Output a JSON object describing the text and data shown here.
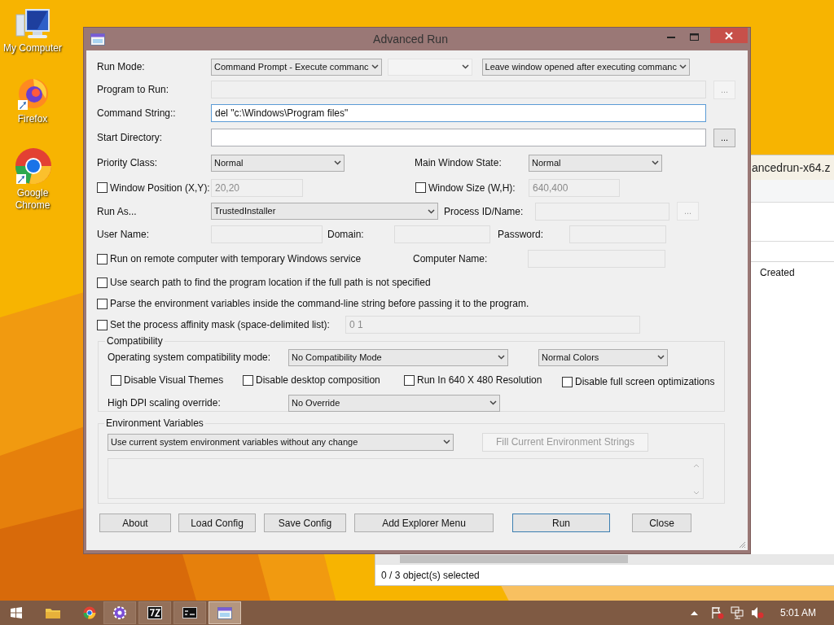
{
  "desktop_icons": [
    {
      "label": "My Computer",
      "kind": "computer"
    },
    {
      "label": "Firefox",
      "kind": "firefox"
    },
    {
      "label": "Google Chrome",
      "kind": "chrome"
    }
  ],
  "background_window": {
    "title": "ancedrun-x64.z",
    "column_header": "Created",
    "status": "0 / 3 object(s) selected"
  },
  "dialog": {
    "title": "Advanced Run",
    "run_mode": {
      "label": "Run Mode:",
      "mode": "Command Prompt - Execute commanc",
      "secondary_disabled": true,
      "window_option": "Leave window opened after executing commanc"
    },
    "program": {
      "label": "Program to Run:",
      "disabled": true,
      "browse": "...",
      "browse_disabled": true
    },
    "command": {
      "label": "Command String::",
      "value": "del \"c:\\Windows\\Program files\"",
      "focused": true
    },
    "start_dir": {
      "label": "Start Directory:",
      "disabled": false,
      "browse": "...",
      "browse_disabled": false
    },
    "priority": {
      "label": "Priority Class:",
      "value": "Normal"
    },
    "main_window_state": {
      "label": "Main Window State:",
      "value": "Normal"
    },
    "window_position": {
      "label": "Window Position (X,Y):",
      "checked": false,
      "value": "20,20",
      "disabled": true
    },
    "window_size": {
      "label": "Window Size (W,H):",
      "checked": false,
      "value": "640,400",
      "disabled": true
    },
    "run_as": {
      "label": "Run As...",
      "value": "TrustedInstaller"
    },
    "process_id": {
      "label": "Process ID/Name:",
      "disabled": true,
      "browse": "...",
      "browse_disabled": true
    },
    "credentials": [
      {
        "label": "User Name:",
        "disabled": true
      },
      {
        "label": "Domain:",
        "disabled": true
      },
      {
        "label": "Password:",
        "disabled": true
      }
    ],
    "remote": {
      "label": "Run on remote computer with temporary Windows service",
      "checked": false
    },
    "computer_name": {
      "label": "Computer Name:",
      "disabled": true
    },
    "options": [
      {
        "label": "Use search path to find the program location if the full path is not specified",
        "checked": false
      },
      {
        "label": "Parse the environment variables inside the command-line string before passing it to the program.",
        "checked": false
      }
    ],
    "affinity": {
      "label": "Set the process affinity mask (space-delimited list):",
      "checked": false,
      "value": "0 1",
      "disabled": true
    },
    "compatibility": {
      "title": "Compatibility",
      "mode_label": "Operating system compatibility mode:",
      "mode": "No Compatibility Mode",
      "colors": "Normal Colors",
      "checkboxes": [
        {
          "label": "Disable Visual Themes",
          "checked": false
        },
        {
          "label": "Disable desktop composition",
          "checked": false
        },
        {
          "label": "Run In 640 X 480 Resolution",
          "checked": false
        },
        {
          "label": "Disable full screen optimizations",
          "checked": false
        }
      ],
      "dpi_label": "High DPI scaling override:",
      "dpi": "No Override"
    },
    "environment": {
      "title": "Environment Variables",
      "mode": "Use current system environment variables without any change",
      "fill_button": "Fill Current Environment Strings",
      "fill_disabled": true,
      "text_disabled": true
    },
    "buttons": [
      {
        "label": "About",
        "default": false
      },
      {
        "label": "Load Config",
        "default": false
      },
      {
        "label": "Save Config",
        "default": false
      },
      {
        "label": "Add Explorer Menu",
        "default": false
      },
      {
        "label": "Run",
        "default": true
      },
      {
        "label": "Close",
        "default": false
      }
    ]
  },
  "taskbar": {
    "apps": [
      {
        "kind": "settings",
        "active": false
      },
      {
        "kind": "archive",
        "active": false
      },
      {
        "kind": "console",
        "active": false
      },
      {
        "kind": "advancedrun",
        "active": true
      }
    ],
    "clock": "5:01 AM"
  }
}
